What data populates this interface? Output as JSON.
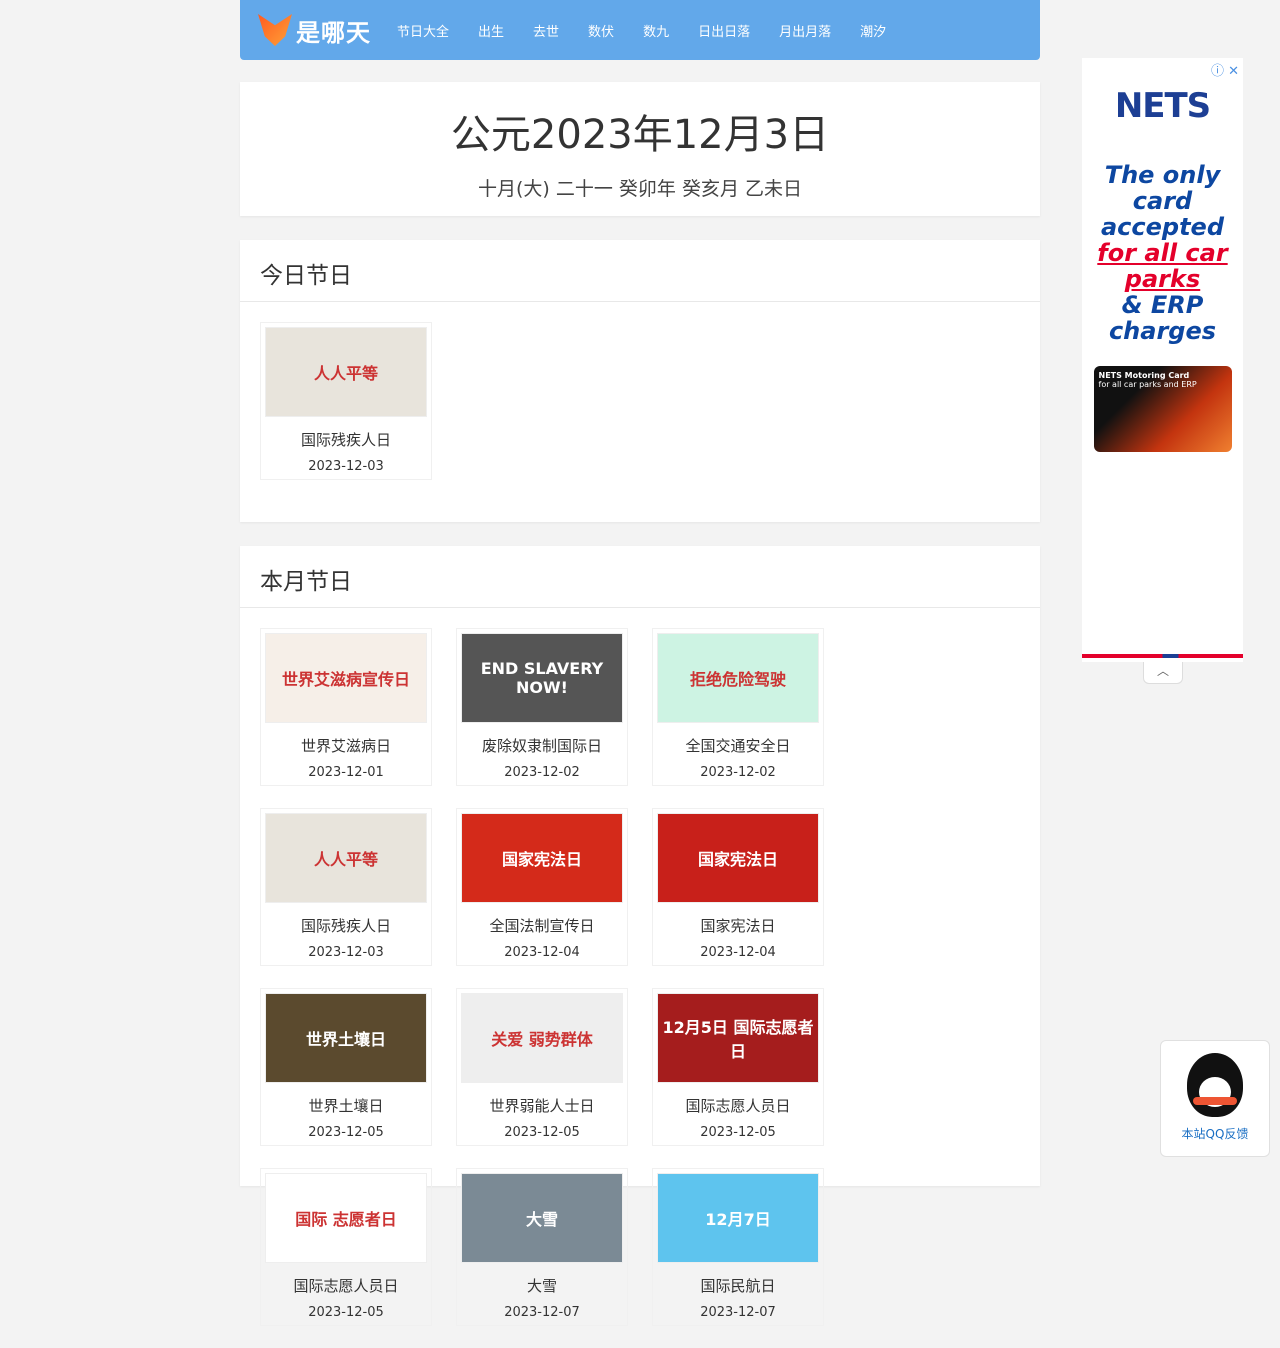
{
  "nav": {
    "logo": "是哪天",
    "items": [
      "节日大全",
      "出生",
      "去世",
      "数伏",
      "数九",
      "日出日落",
      "月出月落",
      "潮汐"
    ]
  },
  "date": {
    "gregorian": "公元2023年12月3日",
    "lunar": "十月(大) 二十一 癸卯年 癸亥月 乙未日"
  },
  "today": {
    "title": "今日节日",
    "items": [
      {
        "name": "国际残疾人日",
        "date": "2023-12-03",
        "thumb": "人人平等",
        "color": "#e8e4dc"
      }
    ]
  },
  "month": {
    "title": "本月节日",
    "items": [
      {
        "name": "世界艾滋病日",
        "date": "2023-12-01",
        "thumb": "世界艾滋病宣传日",
        "color": "#f6efe8"
      },
      {
        "name": "废除奴隶制国际日",
        "date": "2023-12-02",
        "thumb": "END SLAVERY NOW!",
        "color": "#555"
      },
      {
        "name": "全国交通安全日",
        "date": "2023-12-02",
        "thumb": "拒绝危险驾驶",
        "color": "#cdf3e3"
      },
      {
        "name": "国际残疾人日",
        "date": "2023-12-03",
        "thumb": "人人平等",
        "color": "#e8e4dc"
      },
      {
        "name": "全国法制宣传日",
        "date": "2023-12-04",
        "thumb": "国家宪法日",
        "color": "#d42a1a"
      },
      {
        "name": "国家宪法日",
        "date": "2023-12-04",
        "thumb": "国家宪法日",
        "color": "#c8201a"
      },
      {
        "name": "世界土壤日",
        "date": "2023-12-05",
        "thumb": "世界土壤日",
        "color": "#5b4a2e"
      },
      {
        "name": "世界弱能人士日",
        "date": "2023-12-05",
        "thumb": "关爱 弱势群体",
        "color": "#eeeeee"
      },
      {
        "name": "国际志愿人员日",
        "date": "2023-12-05",
        "thumb": "12月5日 国际志愿者日",
        "color": "#a51d1d"
      },
      {
        "name": "国际志愿人员日",
        "date": "2023-12-05",
        "thumb": "国际 志愿者日",
        "color": "#ffffff"
      },
      {
        "name": "大雪",
        "date": "2023-12-07",
        "thumb": "大雪",
        "color": "#7b8a95"
      },
      {
        "name": "国际民航日",
        "date": "2023-12-07",
        "thumb": "12月7日",
        "color": "#5ec4ee"
      }
    ]
  },
  "ad": {
    "brand": "NETS",
    "line1": "The only card",
    "line2": "accepted",
    "line3": "for all car",
    "line4": "parks",
    "line5": "& ERP",
    "line6": "charges",
    "card_title": "NETS Motoring Card",
    "card_sub": "for all car parks and ERP",
    "close": "ⓘ ✕",
    "toggle": "︿"
  },
  "qq": {
    "label": "本站QQ反馈"
  }
}
